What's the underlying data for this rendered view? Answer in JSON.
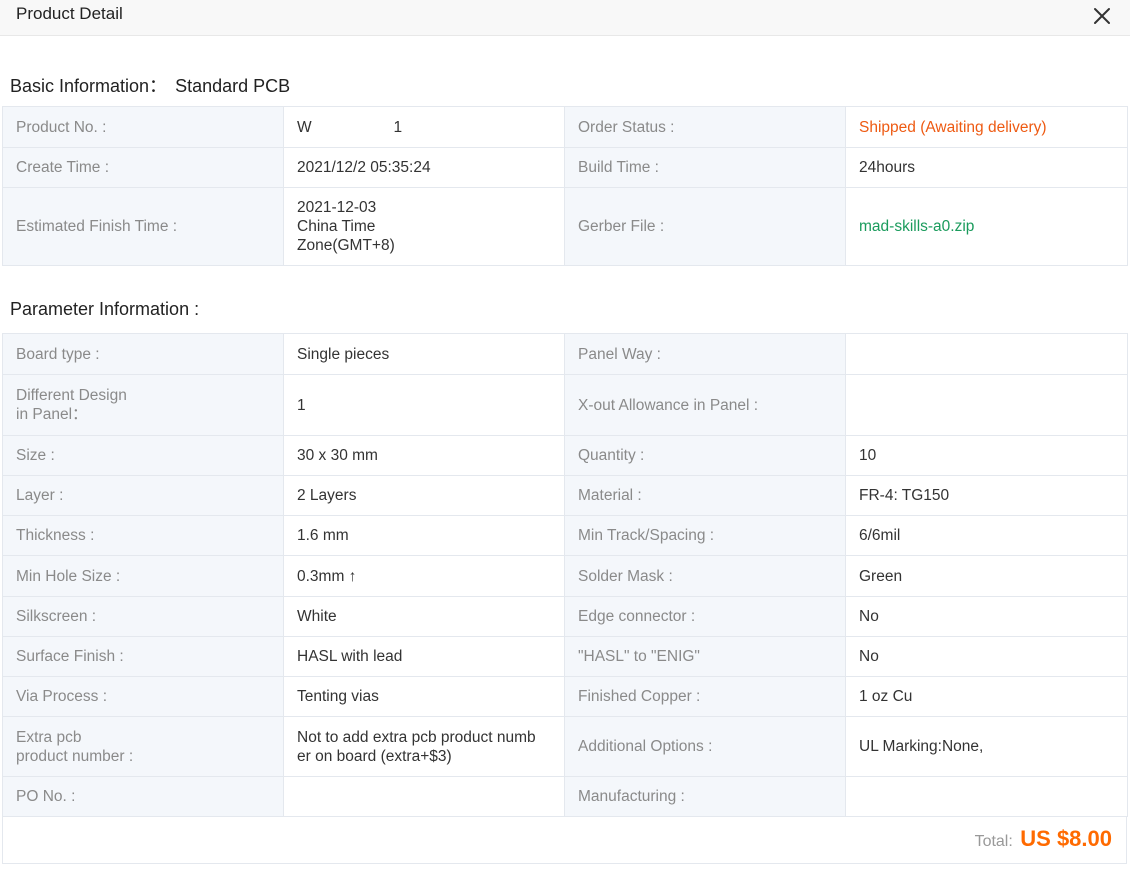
{
  "header": {
    "title": "Product Detail",
    "close_icon": "close-icon"
  },
  "basic": {
    "title": "Basic Information：",
    "subtitle": "Standard PCB",
    "product_no_label": "Product No. :",
    "product_no_value": "W                   1",
    "order_status_label": "Order Status :",
    "order_status_value": "Shipped (Awaiting delivery)",
    "create_time_label": "Create Time :",
    "create_time_value": "2021/12/2 05:35:24",
    "build_time_label": "Build Time :",
    "build_time_value": "24hours",
    "finish_label": "Estimated Finish Time :",
    "finish_value_line1": "2021-12-03",
    "finish_value_line2": "China Time",
    "finish_value_line3": "Zone(GMT+8)",
    "gerber_label": "Gerber File :",
    "gerber_value": "mad-skills-a0.zip"
  },
  "params": {
    "title": "Parameter Information :",
    "rows": [
      {
        "k1": "Board type :",
        "v1": "Single pieces",
        "k2": "Panel Way :",
        "v2": ""
      },
      {
        "k1a": "Different Design",
        "k1b": "in Panel：",
        "v1": "1",
        "k2": "X-out Allowance in Panel :",
        "v2": ""
      },
      {
        "k1": "Size :",
        "v1": "30 x 30 mm",
        "k2": "Quantity :",
        "v2": "10"
      },
      {
        "k1": "Layer :",
        "v1": "2 Layers",
        "k2": "Material :",
        "v2": "FR-4: TG150"
      },
      {
        "k1": "Thickness :",
        "v1": "1.6 mm",
        "k2": "Min Track/Spacing :",
        "v2": "6/6mil"
      },
      {
        "k1": "Min Hole Size :",
        "v1": "0.3mm ↑",
        "k2": "Solder Mask :",
        "v2": "Green"
      },
      {
        "k1": "Silkscreen :",
        "v1": "White",
        "k2": "Edge connector :",
        "v2": "No"
      },
      {
        "k1": "Surface Finish :",
        "v1": "HASL with lead",
        "k2": "\"HASL\" to \"ENIG\"",
        "v2": "No"
      },
      {
        "k1": "Via Process :",
        "v1": "Tenting vias",
        "k2": "Finished Copper :",
        "v2": "1 oz Cu"
      },
      {
        "k1a": "Extra pcb",
        "k1b": "product number :",
        "v1a": "Not to add extra pcb product numb",
        "v1b": "er on board (extra+$3)",
        "k2": "Additional Options :",
        "v2": "UL Marking:None,"
      },
      {
        "k1": "PO No. :",
        "v1": "",
        "k2": "Manufacturing :",
        "v2": ""
      }
    ]
  },
  "total": {
    "label": "Total:",
    "amount": "US $8.00"
  },
  "colors": {
    "status": "#ee5a12",
    "file_link": "#1a9b5c",
    "total": "#ff6a00",
    "label_bg": "#f4f7fb"
  }
}
